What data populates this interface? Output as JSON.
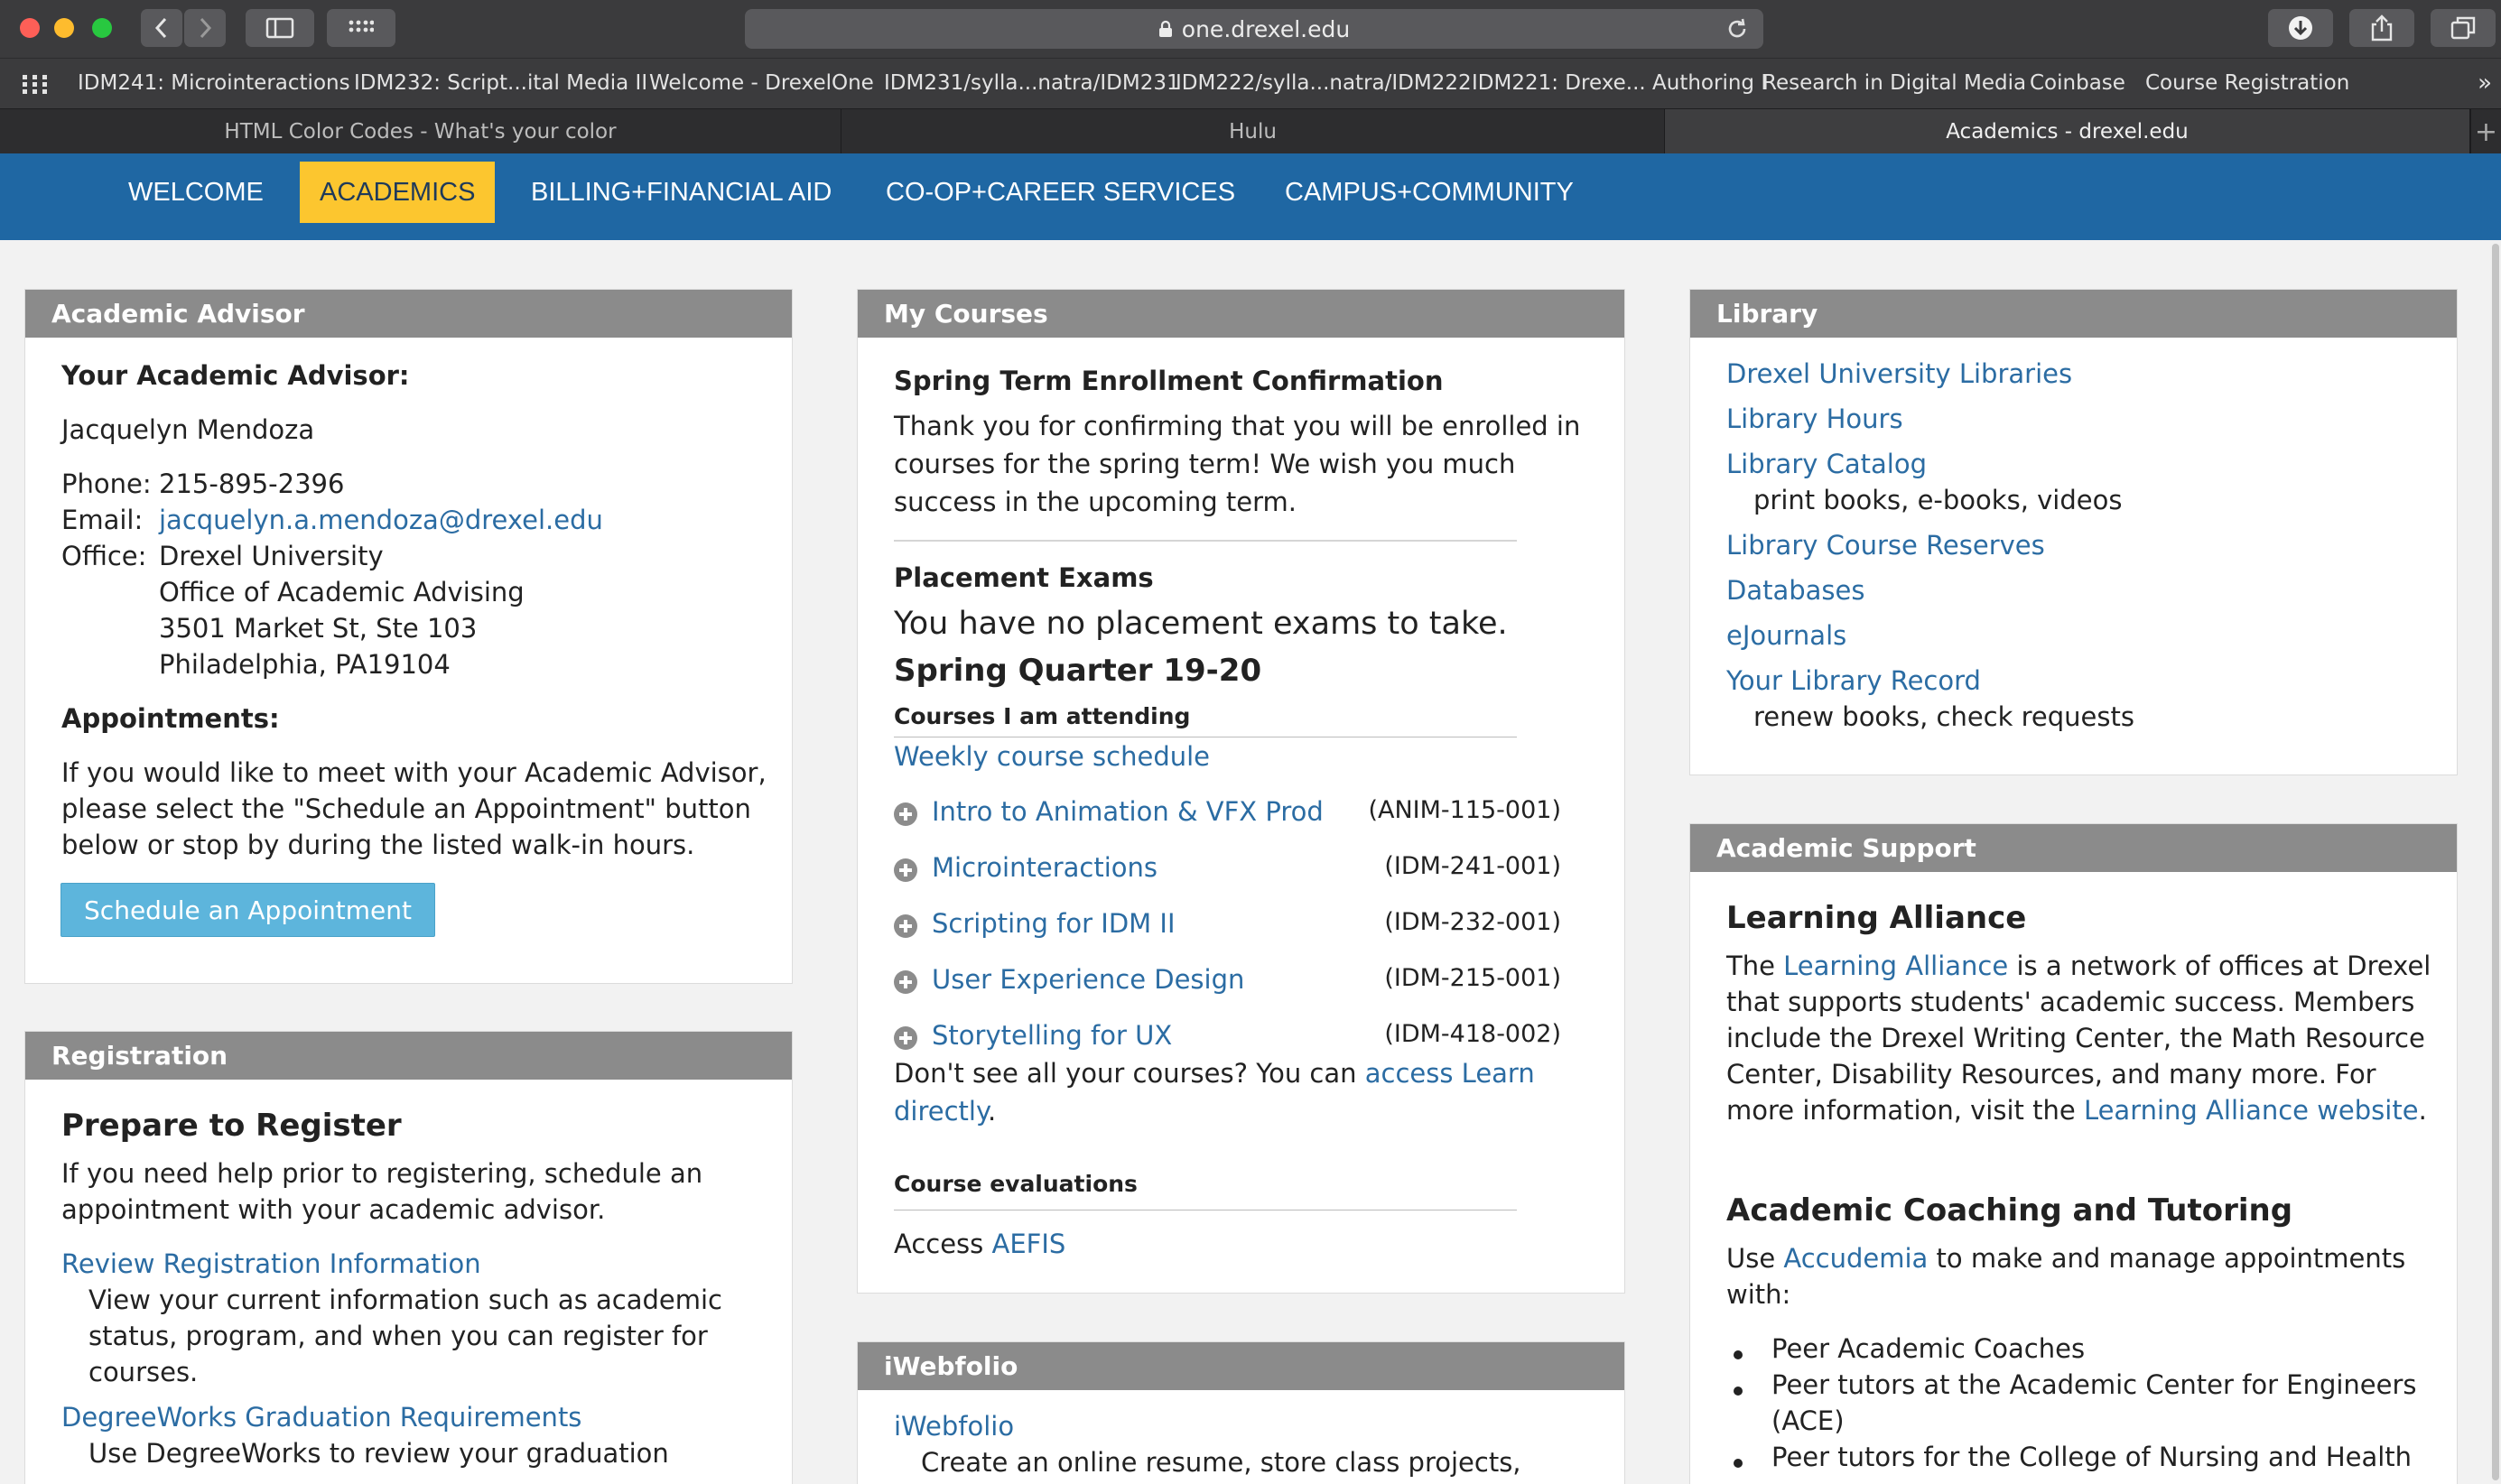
{
  "browser": {
    "url": "one.drexel.edu",
    "bookmarks": [
      "IDM241: Microinteractions",
      "IDM232: Script...ital Media II",
      "Welcome - DrexelOne",
      "IDM231/sylla...natra/IDM231",
      "IDM222/sylla...natra/IDM222",
      "IDM221: Drexe... Authoring I",
      "Research in Digital Media",
      "Coinbase",
      "Course Registration"
    ],
    "more_glyph": "»",
    "tabs": [
      "HTML Color Codes - What's your color",
      "Hulu",
      "Academics - drexel.edu"
    ],
    "new_tab_glyph": "+"
  },
  "nav": {
    "items": [
      "WELCOME",
      "ACADEMICS",
      "BILLING+FINANCIAL AID",
      "CO-OP+CAREER SERVICES",
      "CAMPUS+COMMUNITY"
    ],
    "active_color": "#fcc62f",
    "bar_color": "#1f67a3"
  },
  "advisor": {
    "title": "Academic Advisor",
    "your_advisor_label": "Your Academic Advisor:",
    "name": "Jacquelyn Mendoza",
    "phone_label": "Phone:",
    "phone": "215-895-2396",
    "email_label": "Email:",
    "email": "jacquelyn.a.mendoza@drexel.edu",
    "office_label": "Office:",
    "office_lines": [
      "Drexel University",
      "Office of Academic Advising",
      "3501 Market St, Ste 103",
      "Philadelphia, PA19104"
    ],
    "appointments_label": "Appointments:",
    "appointments_text": [
      "If you would like to meet with your Academic Advisor,",
      "please select the \"Schedule an Appointment\" button",
      "below or stop by during the listed walk-in hours."
    ],
    "button": "Schedule an Appointment"
  },
  "registration": {
    "title": "Registration",
    "heading": "Prepare to Register",
    "intro": [
      "If you need help prior to registering, schedule an",
      "appointment with your academic advisor."
    ],
    "review_link": "Review Registration Information",
    "review_desc": [
      "View your current information such as academic",
      "status, program, and when you can register for",
      "courses."
    ],
    "degreeworks_link": "DegreeWorks Graduation Requirements",
    "degreeworks_desc": "Use DegreeWorks to review your graduation"
  },
  "courses": {
    "title": "My Courses",
    "enroll_heading": "Spring Term Enrollment Confirmation",
    "enroll_text": [
      "Thank you for confirming that you will be enrolled in",
      "courses for the spring term! We wish you much",
      "success in the upcoming term."
    ],
    "placement_heading": "Placement Exams",
    "placement_text": "You have no placement exams to take.",
    "term": "Spring Quarter 19-20",
    "attending_label": "Courses I am attending",
    "weekly_link": "Weekly course schedule",
    "list": [
      {
        "name": "Intro to Animation & VFX Prod",
        "code": "(ANIM-115-001)"
      },
      {
        "name": "Microinteractions",
        "code": "(IDM-241-001)"
      },
      {
        "name": "Scripting for IDM II",
        "code": "(IDM-232-001)"
      },
      {
        "name": "User Experience Design",
        "code": "(IDM-215-001)"
      },
      {
        "name": "Storytelling for UX",
        "code": "(IDM-418-002)"
      }
    ],
    "missing_text_1": "Don't see all your courses? You can ",
    "missing_link_1": "access Learn",
    "missing_link_2": "directly",
    "missing_period": ".",
    "eval_label": "Course evaluations",
    "access_text": "Access ",
    "aefis_link": "AEFIS"
  },
  "iwebfolio": {
    "title": "iWebfolio",
    "link": "iWebfolio",
    "desc": "Create an online resume, store class projects,"
  },
  "library": {
    "title": "Library",
    "links": [
      "Drexel University Libraries",
      "Library Hours",
      "Library Catalog",
      "Library Course Reserves",
      "Databases",
      "eJournals",
      "Your Library Record"
    ],
    "catalog_desc": "print books, e-books, videos",
    "record_desc": "renew books, check requests"
  },
  "support": {
    "title": "Academic Support",
    "la_heading": "Learning Alliance",
    "la_pre": "The ",
    "la_link": "Learning Alliance",
    "la_post": " is a network of offices at Drexel",
    "la_lines": [
      "that supports students' academic success. Members",
      "include the Drexel Writing Center, the Math Resource",
      "Center, Disability Resources, and many more. For"
    ],
    "la_last_pre": "more information, visit the ",
    "la_site_link": "Learning Alliance website",
    "la_last_post": ".",
    "coach_heading": "Academic Coaching and Tutoring",
    "use_pre": "Use ",
    "accudemia_link": "Accudemia",
    "use_post": " to make and manage appointments",
    "with_text": "with:",
    "bullets": [
      "Peer Academic Coaches",
      "Peer tutors at the Academic Center for Engineers",
      "(ACE)",
      "Peer tutors for the College of Nursing and Health"
    ]
  }
}
